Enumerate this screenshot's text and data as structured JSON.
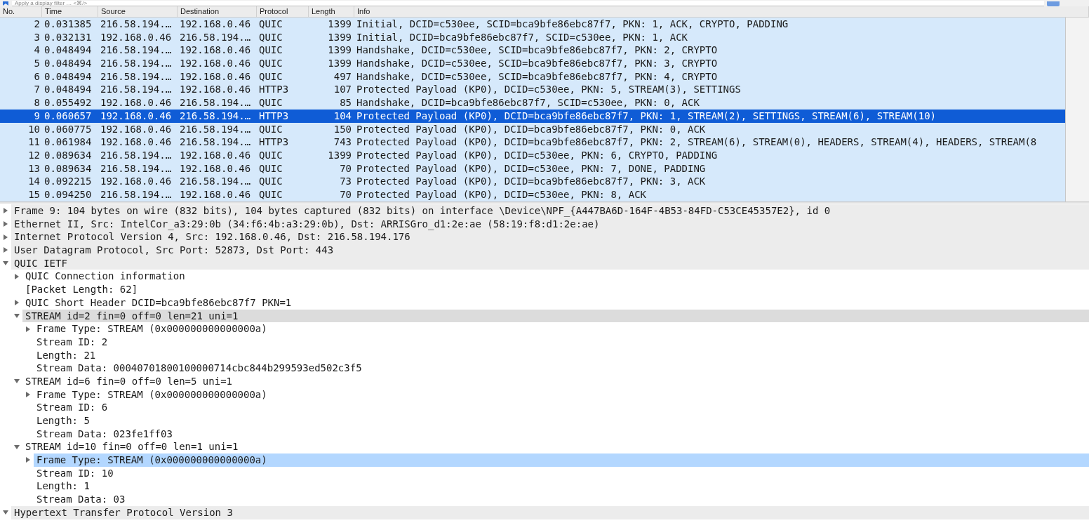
{
  "filter_bar": {
    "placeholder": "Apply a display filter … <⌘/>"
  },
  "packet_list": {
    "columns": [
      "No.",
      "Time",
      "Source",
      "Destination",
      "Protocol",
      "Length",
      "Info"
    ],
    "rows": [
      {
        "no": "2",
        "time": "0.031385",
        "source": "216.58.194.…",
        "destination": "192.168.0.46",
        "protocol": "QUIC",
        "length": "1399",
        "info": "Initial, DCID=c530ee, SCID=bca9bfe86ebc87f7, PKN: 1, ACK, CRYPTO, PADDING",
        "selected": false
      },
      {
        "no": "3",
        "time": "0.032131",
        "source": "192.168.0.46",
        "destination": "216.58.194.…",
        "protocol": "QUIC",
        "length": "1399",
        "info": "Initial, DCID=bca9bfe86ebc87f7, SCID=c530ee, PKN: 1, ACK",
        "selected": false
      },
      {
        "no": "4",
        "time": "0.048494",
        "source": "216.58.194.…",
        "destination": "192.168.0.46",
        "protocol": "QUIC",
        "length": "1399",
        "info": "Handshake, DCID=c530ee, SCID=bca9bfe86ebc87f7, PKN: 2, CRYPTO",
        "selected": false
      },
      {
        "no": "5",
        "time": "0.048494",
        "source": "216.58.194.…",
        "destination": "192.168.0.46",
        "protocol": "QUIC",
        "length": "1399",
        "info": "Handshake, DCID=c530ee, SCID=bca9bfe86ebc87f7, PKN: 3, CRYPTO",
        "selected": false
      },
      {
        "no": "6",
        "time": "0.048494",
        "source": "216.58.194.…",
        "destination": "192.168.0.46",
        "protocol": "QUIC",
        "length": "497",
        "info": "Handshake, DCID=c530ee, SCID=bca9bfe86ebc87f7, PKN: 4, CRYPTO",
        "selected": false
      },
      {
        "no": "7",
        "time": "0.048494",
        "source": "216.58.194.…",
        "destination": "192.168.0.46",
        "protocol": "HTTP3",
        "length": "107",
        "info": "Protected Payload (KP0), DCID=c530ee, PKN: 5, STREAM(3), SETTINGS",
        "selected": false
      },
      {
        "no": "8",
        "time": "0.055492",
        "source": "192.168.0.46",
        "destination": "216.58.194.…",
        "protocol": "QUIC",
        "length": "85",
        "info": "Handshake, DCID=bca9bfe86ebc87f7, SCID=c530ee, PKN: 0, ACK",
        "selected": false
      },
      {
        "no": "9",
        "time": "0.060657",
        "source": "192.168.0.46",
        "destination": "216.58.194.…",
        "protocol": "HTTP3",
        "length": "104",
        "info": "Protected Payload (KP0), DCID=bca9bfe86ebc87f7, PKN: 1, STREAM(2), SETTINGS, STREAM(6), STREAM(10)",
        "selected": true
      },
      {
        "no": "10",
        "time": "0.060775",
        "source": "192.168.0.46",
        "destination": "216.58.194.…",
        "protocol": "QUIC",
        "length": "150",
        "info": "Protected Payload (KP0), DCID=bca9bfe86ebc87f7, PKN: 0, ACK",
        "selected": false
      },
      {
        "no": "11",
        "time": "0.061984",
        "source": "192.168.0.46",
        "destination": "216.58.194.…",
        "protocol": "HTTP3",
        "length": "743",
        "info": "Protected Payload (KP0), DCID=bca9bfe86ebc87f7, PKN: 2, STREAM(6), STREAM(0), HEADERS, STREAM(4), HEADERS, STREAM(8",
        "selected": false
      },
      {
        "no": "12",
        "time": "0.089634",
        "source": "216.58.194.…",
        "destination": "192.168.0.46",
        "protocol": "QUIC",
        "length": "1399",
        "info": "Protected Payload (KP0), DCID=c530ee, PKN: 6, CRYPTO, PADDING",
        "selected": false
      },
      {
        "no": "13",
        "time": "0.089634",
        "source": "216.58.194.…",
        "destination": "192.168.0.46",
        "protocol": "QUIC",
        "length": "70",
        "info": "Protected Payload (KP0), DCID=c530ee, PKN: 7, DONE, PADDING",
        "selected": false
      },
      {
        "no": "14",
        "time": "0.092215",
        "source": "192.168.0.46",
        "destination": "216.58.194.…",
        "protocol": "QUIC",
        "length": "73",
        "info": "Protected Payload (KP0), DCID=bca9bfe86ebc87f7, PKN: 3, ACK",
        "selected": false
      },
      {
        "no": "15",
        "time": "0.094250",
        "source": "216.58.194.…",
        "destination": "192.168.0.46",
        "protocol": "QUIC",
        "length": "70",
        "info": "Protected Payload (KP0), DCID=c530ee, PKN: 8, ACK",
        "selected": false
      }
    ]
  },
  "detail_tree": [
    {
      "label": "Frame 9: 104 bytes on wire (832 bits), 104 bytes captured (832 bits) on interface \\Device\\NPF_{A447BA6D-164F-4B53-84FD-C53CE45357E2}, id 0",
      "expanded": false,
      "selected": false,
      "hovered": false
    },
    {
      "label": "Ethernet II, Src: IntelCor_a3:29:0b (34:f6:4b:a3:29:0b), Dst: ARRISGro_d1:2e:ae (58:19:f8:d1:2e:ae)",
      "expanded": false,
      "selected": false,
      "hovered": false
    },
    {
      "label": "Internet Protocol Version 4, Src: 192.168.0.46, Dst: 216.58.194.176",
      "expanded": false,
      "selected": false,
      "hovered": false
    },
    {
      "label": "User Datagram Protocol, Src Port: 52873, Dst Port: 443",
      "expanded": false,
      "selected": false,
      "hovered": false
    },
    {
      "label": "QUIC IETF",
      "expanded": true,
      "selected": false,
      "hovered": false,
      "children": [
        {
          "label": "QUIC Connection information",
          "expanded": false,
          "selected": false,
          "hovered": false
        },
        {
          "label": "[Packet Length: 62]",
          "selected": false,
          "hovered": false
        },
        {
          "label": "QUIC Short Header DCID=bca9bfe86ebc87f7 PKN=1",
          "expanded": false,
          "selected": false,
          "hovered": false
        },
        {
          "label": "STREAM id=2 fin=0 off=0 len=21 uni=1",
          "expanded": true,
          "selected": false,
          "hovered": true,
          "children": [
            {
              "label": "Frame Type: STREAM (0x000000000000000a)",
              "expanded": false,
              "selected": false,
              "hovered": false
            },
            {
              "label": "Stream ID: 2",
              "selected": false,
              "hovered": false
            },
            {
              "label": "Length: 21",
              "selected": false,
              "hovered": false
            },
            {
              "label": "Stream Data: 00040701800100000714cbc844b299593ed502c3f5",
              "selected": false,
              "hovered": false
            }
          ]
        },
        {
          "label": "STREAM id=6 fin=0 off=0 len=5 uni=1",
          "expanded": true,
          "selected": false,
          "hovered": false,
          "children": [
            {
              "label": "Frame Type: STREAM (0x000000000000000a)",
              "expanded": false,
              "selected": false,
              "hovered": false
            },
            {
              "label": "Stream ID: 6",
              "selected": false,
              "hovered": false
            },
            {
              "label": "Length: 5",
              "selected": false,
              "hovered": false
            },
            {
              "label": "Stream Data: 023fe1ff03",
              "selected": false,
              "hovered": false
            }
          ]
        },
        {
          "label": "STREAM id=10 fin=0 off=0 len=1 uni=1",
          "expanded": true,
          "selected": false,
          "hovered": false,
          "children": [
            {
              "label": "Frame Type: STREAM (0x000000000000000a)",
              "expanded": false,
              "selected": true,
              "hovered": false
            },
            {
              "label": "Stream ID: 10",
              "selected": false,
              "hovered": false
            },
            {
              "label": "Length: 1",
              "selected": false,
              "hovered": false
            },
            {
              "label": "Stream Data: 03",
              "selected": false,
              "hovered": false
            }
          ]
        }
      ]
    },
    {
      "label": "Hypertext Transfer Protocol Version 3",
      "expanded": true,
      "selected": false,
      "hovered": false
    }
  ]
}
